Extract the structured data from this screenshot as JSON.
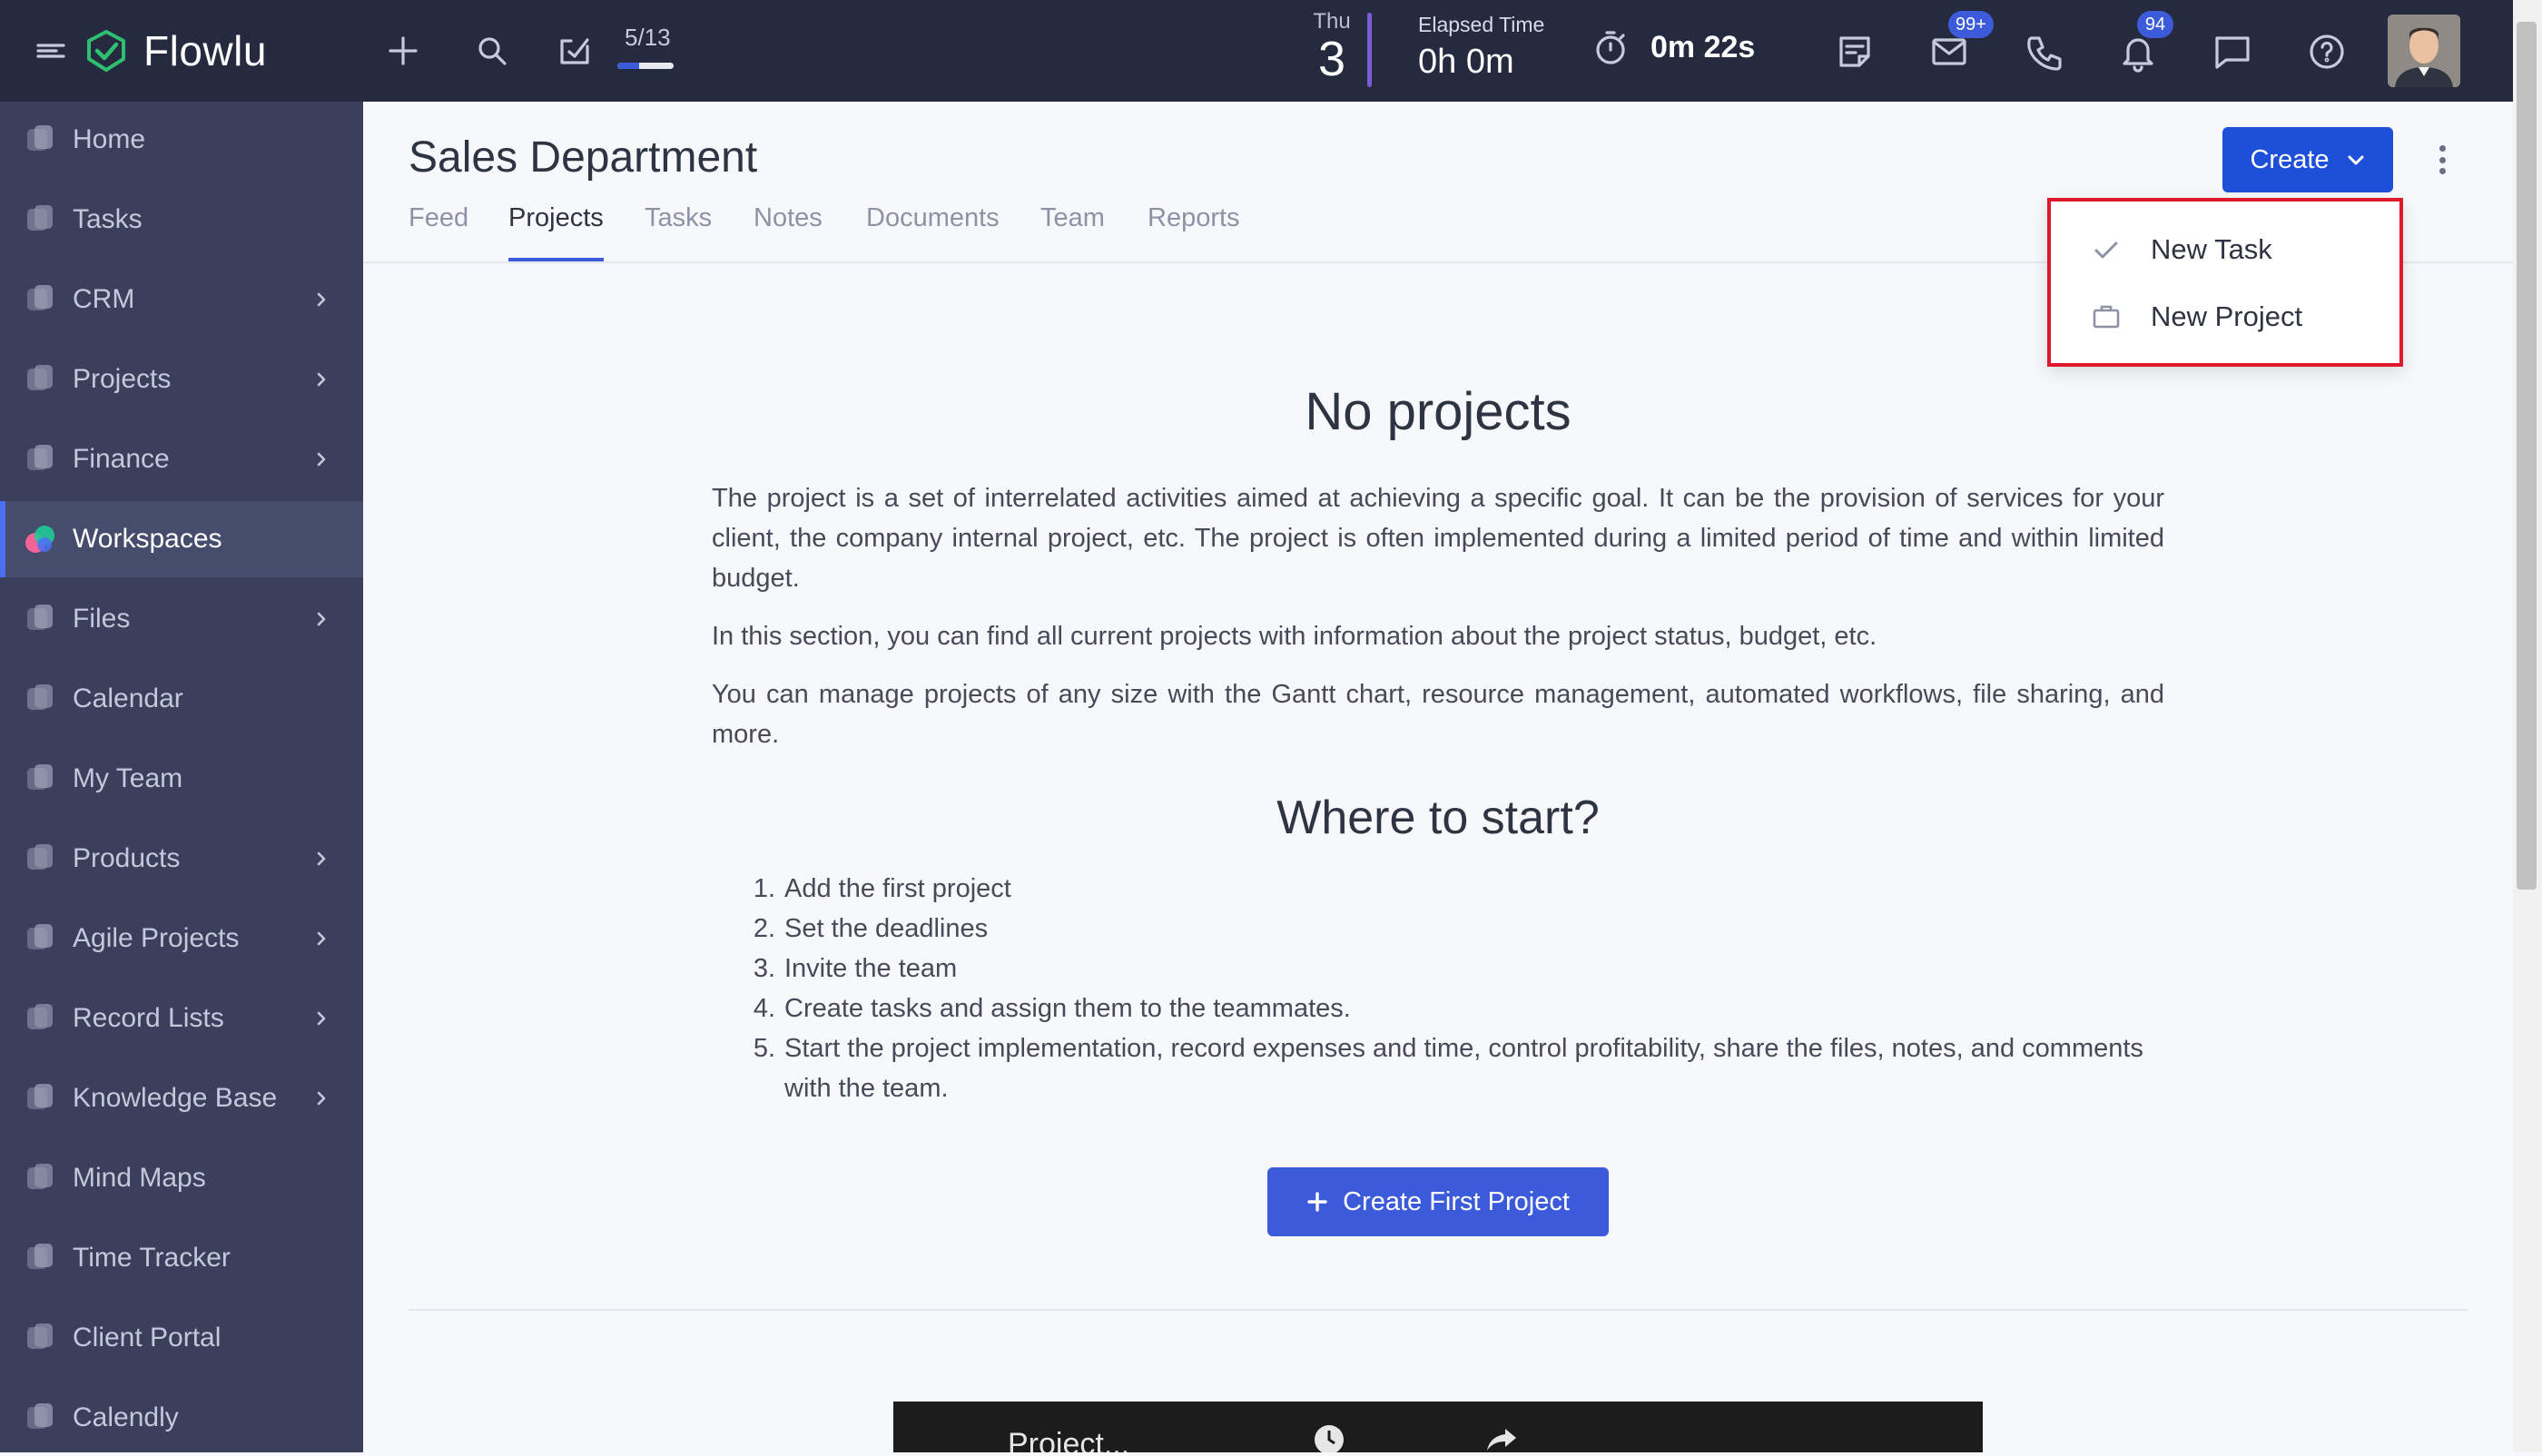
{
  "topbar": {
    "brand": "Flowlu",
    "progress_text": "5/13",
    "progress_fraction": 0.38,
    "date_day": "Thu",
    "date_num": "3",
    "elapsed_label": "Elapsed Time",
    "elapsed_value": "0h 0m",
    "timer_value": "0m 22s",
    "mail_badge": "99+",
    "notif_badge": "94"
  },
  "sidebar": {
    "items": [
      {
        "label": "Home",
        "icon": "home-icon",
        "chevron": false
      },
      {
        "label": "Tasks",
        "icon": "tasks-icon",
        "chevron": false
      },
      {
        "label": "CRM",
        "icon": "crm-icon",
        "chevron": true
      },
      {
        "label": "Projects",
        "icon": "projects-icon",
        "chevron": true
      },
      {
        "label": "Finance",
        "icon": "finance-icon",
        "chevron": true
      },
      {
        "label": "Workspaces",
        "icon": "workspaces-icon",
        "chevron": false,
        "active": true
      },
      {
        "label": "Files",
        "icon": "files-icon",
        "chevron": true
      },
      {
        "label": "Calendar",
        "icon": "calendar-icon",
        "chevron": false
      },
      {
        "label": "My Team",
        "icon": "team-icon",
        "chevron": false
      },
      {
        "label": "Products",
        "icon": "products-icon",
        "chevron": true
      },
      {
        "label": "Agile Projects",
        "icon": "agile-icon",
        "chevron": true
      },
      {
        "label": "Record Lists",
        "icon": "record-lists-icon",
        "chevron": true
      },
      {
        "label": "Knowledge Base",
        "icon": "knowledge-base-icon",
        "chevron": true
      },
      {
        "label": "Mind Maps",
        "icon": "mind-maps-icon",
        "chevron": false
      },
      {
        "label": "Time Tracker",
        "icon": "time-tracker-icon",
        "chevron": false
      },
      {
        "label": "Client Portal",
        "icon": "client-portal-icon",
        "chevron": false
      },
      {
        "label": "Calendly",
        "icon": "calendly-icon",
        "chevron": false
      }
    ]
  },
  "main": {
    "title": "Sales Department",
    "tabs": [
      {
        "label": "Feed"
      },
      {
        "label": "Projects",
        "active": true
      },
      {
        "label": "Tasks"
      },
      {
        "label": "Notes"
      },
      {
        "label": "Documents"
      },
      {
        "label": "Team"
      },
      {
        "label": "Reports"
      }
    ],
    "create_label": "Create",
    "dropdown": [
      {
        "label": "New Task",
        "icon": "check-icon"
      },
      {
        "label": "New Project",
        "icon": "briefcase-icon"
      }
    ],
    "heading": "No projects",
    "paragraphs": [
      "The project is a set of interrelated activities aimed at achieving a specific goal. It can be the provision of services for your client, the company internal project, etc. The project is often implemented during a limited period of time and within limited budget.",
      "In this section, you can find all current projects with information about the project status, budget, etc.",
      "You can manage projects of any size with the Gantt chart, resource management, automated workflows, file sharing, and more."
    ],
    "subheading": "Where to start?",
    "steps": [
      "Add the first project",
      "Set the deadlines",
      "Invite the team",
      "Create tasks and assign them to the teammates.",
      "Start the project implementation, record expenses and time, control profitability, share the files, notes, and comments with the team."
    ],
    "create_first_label": "Create First Project",
    "video_title": "Project..."
  },
  "colors": {
    "accent": "#3b5bdb",
    "topbar": "#262a3e",
    "sidebar": "#3a3f5c",
    "highlight": "#e0182b"
  }
}
